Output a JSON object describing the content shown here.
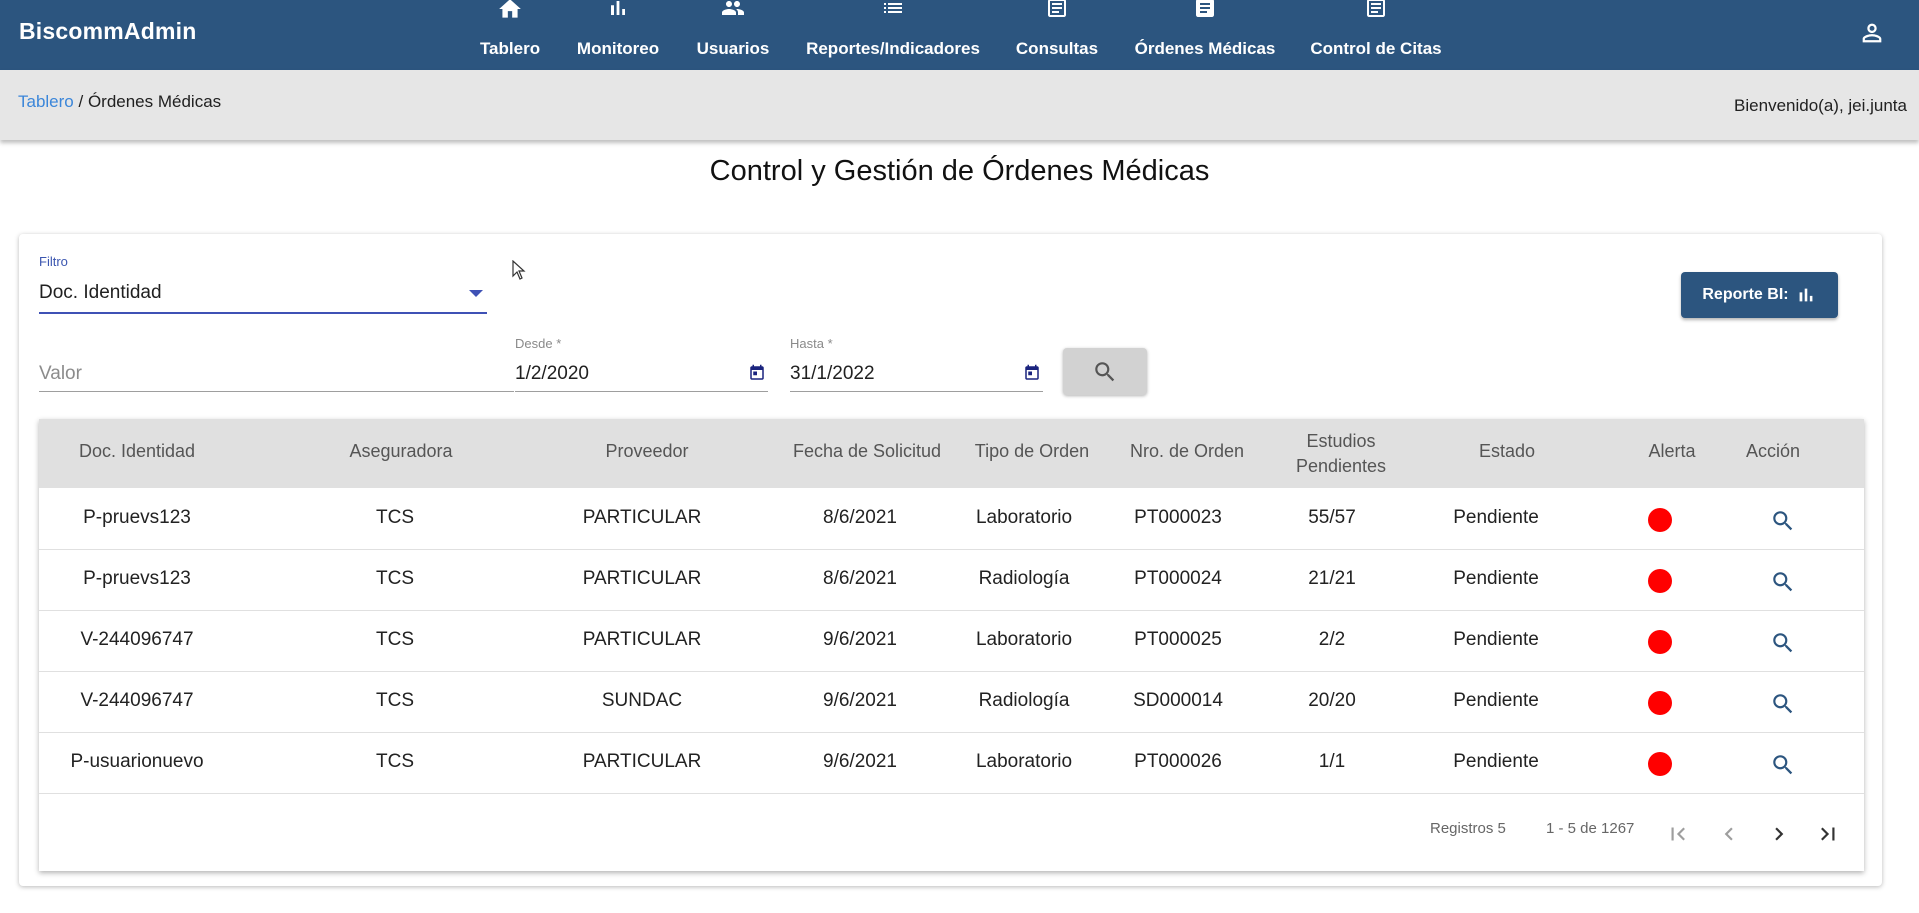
{
  "app": {
    "title": "BiscommAdmin"
  },
  "nav": [
    {
      "label": "Tablero",
      "icon": "home-icon"
    },
    {
      "label": "Monitoreo",
      "icon": "bar-chart-icon"
    },
    {
      "label": "Usuarios",
      "icon": "people-icon"
    },
    {
      "label": "Reportes/Indicadores",
      "icon": "list-icon"
    },
    {
      "label": "Consultas",
      "icon": "article-icon"
    },
    {
      "label": "Órdenes Médicas",
      "icon": "document-icon"
    },
    {
      "label": "Control de Citas",
      "icon": "article-icon"
    }
  ],
  "breadcrumb": {
    "link": "Tablero",
    "separator": " / ",
    "current": "Órdenes Médicas"
  },
  "welcome": "Bienvenido(a), jei.junta",
  "page_title": "Control y Gestión de Órdenes Médicas",
  "filters": {
    "filter_label": "Filtro",
    "filter_value": "Doc. Identidad",
    "value_placeholder": "Valor",
    "from_label": "Desde *",
    "from_value": "1/2/2020",
    "to_label": "Hasta *",
    "to_value": "31/1/2022",
    "report_button": "Reporte BI:"
  },
  "table": {
    "columns": [
      "Doc. Identidad",
      "Aseguradora",
      "Proveedor",
      "Fecha de Solicitud",
      "Tipo de Orden",
      "Nro. de Orden",
      "Estudios Pendientes",
      "Estado",
      "Alerta",
      "Acción"
    ],
    "rows": [
      [
        "P-pruevs123",
        "TCS",
        "PARTICULAR",
        "8/6/2021",
        "Laboratorio",
        "PT000023",
        "55/57",
        "Pendiente"
      ],
      [
        "P-pruevs123",
        "TCS",
        "PARTICULAR",
        "8/6/2021",
        "Radiología",
        "PT000024",
        "21/21",
        "Pendiente"
      ],
      [
        "V-244096747",
        "TCS",
        "PARTICULAR",
        "9/6/2021",
        "Laboratorio",
        "PT000025",
        "2/2",
        "Pendiente"
      ],
      [
        "V-244096747",
        "TCS",
        "SUNDAC",
        "9/6/2021",
        "Radiología",
        "SD000014",
        "20/20",
        "Pendiente"
      ],
      [
        "P-usuarionuevo",
        "TCS",
        "PARTICULAR",
        "9/6/2021",
        "Laboratorio",
        "PT000026",
        "1/1",
        "Pendiente"
      ]
    ],
    "alert_color": "#ff0000"
  },
  "pagination": {
    "records": "Registros 5",
    "range": "1 - 5 de 1267"
  },
  "colors": {
    "primary": "#2c557f",
    "link": "#3b86d9",
    "focus": "#3f51b5"
  }
}
